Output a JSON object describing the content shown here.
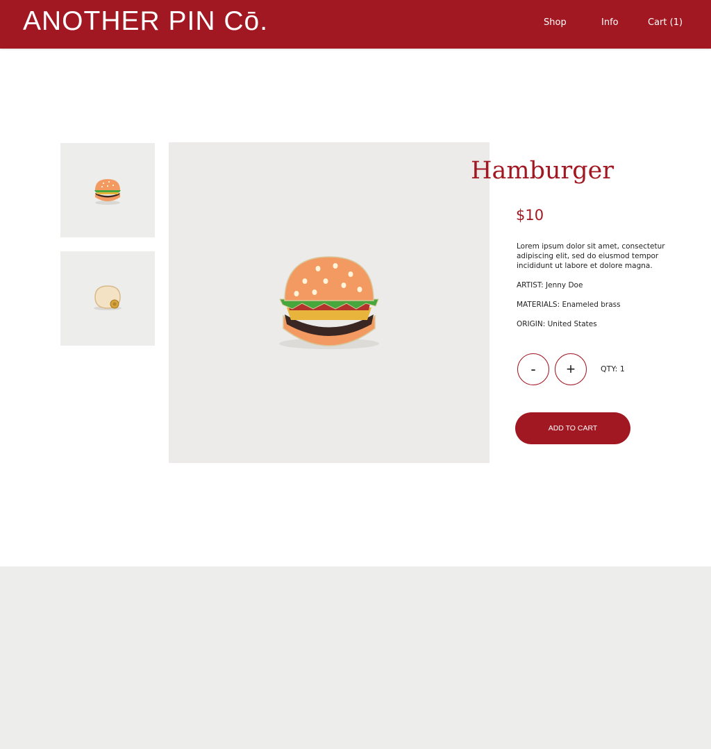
{
  "header": {
    "logo": "ANOTHER PIN Cō.",
    "nav": {
      "shop": "Shop",
      "info": "Info",
      "cart": "Cart (1)"
    },
    "background_color": "#a11822"
  },
  "product": {
    "title": "Hamburger",
    "price": "$10",
    "description": "Lorem ipsum dolor sit amet, consectetur adipiscing elit, sed do eiusmod tempor incididunt ut labore et dolore magna.",
    "artist": "ARTIST: Jenny Doe",
    "materials": "MATERIALS: Enameled brass",
    "origin": "ORIGIN: United States",
    "thumbnails": [
      "hamburger-pin-front",
      "hamburger-pin-back"
    ],
    "main_image": "hamburger-pin-front"
  },
  "quantity": {
    "minus": "-",
    "plus": "+",
    "label": "QTY: 1"
  },
  "add_to_cart": "ADD TO CART",
  "colors": {
    "accent": "#a11822",
    "image_bg": "#ecebe9",
    "footer_bg": "#ededeb"
  }
}
